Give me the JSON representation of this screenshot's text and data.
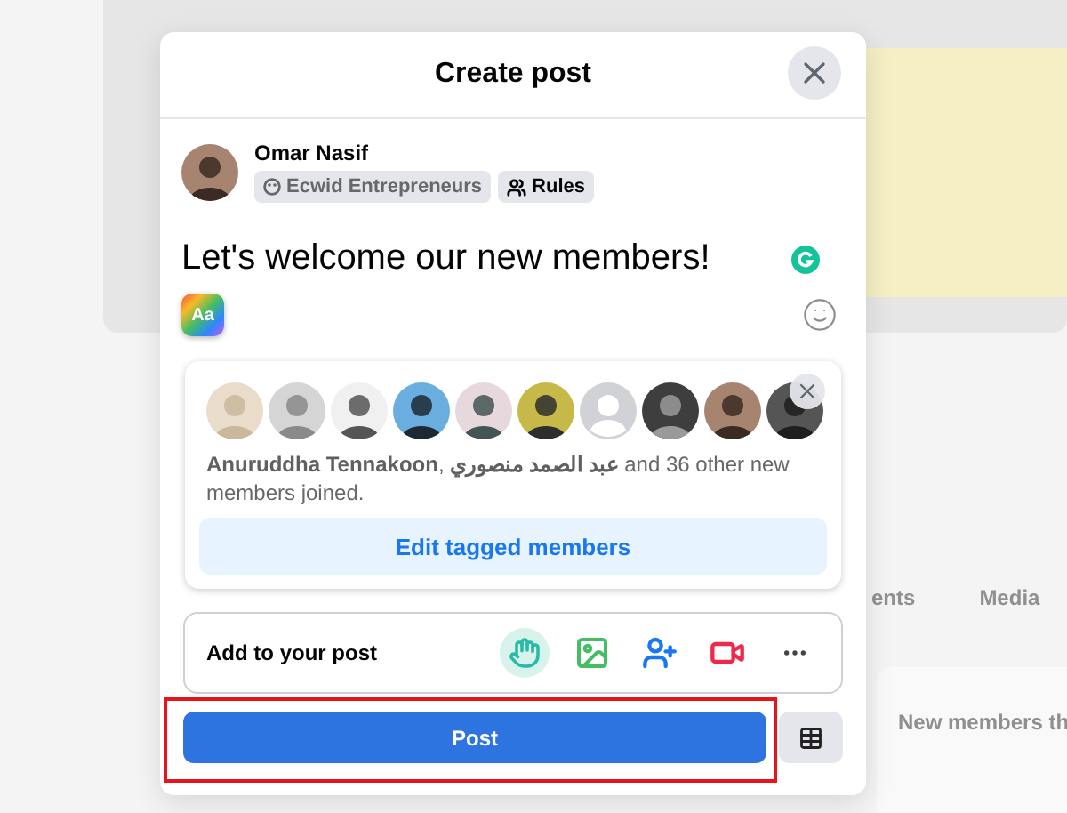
{
  "background": {
    "tabs": [
      "ents",
      "Media"
    ],
    "sidebar_title": "New members th"
  },
  "dialog": {
    "title": "Create post"
  },
  "author": {
    "name": "Omar Nasif",
    "audience": "Ecwid Entrepreneurs",
    "rules": "Rules"
  },
  "post": {
    "text": "Let's welcome our new members!",
    "text_style": "Aa"
  },
  "members": {
    "avatars": [
      {
        "kind": "picture"
      },
      {
        "kind": "picture"
      },
      {
        "kind": "picture"
      },
      {
        "kind": "picture"
      },
      {
        "kind": "picture"
      },
      {
        "kind": "picture"
      },
      {
        "kind": "placeholder"
      },
      {
        "kind": "picture"
      },
      {
        "kind": "picture"
      },
      {
        "kind": "picture"
      }
    ],
    "summary": "**Anuruddha Tennakoon**, **عبد الصمد منصوري** and 36 other new members joined.",
    "edit_button": "Edit tagged members"
  },
  "add_to_post": {
    "label": "Add to your post"
  },
  "post_button": "Post"
}
